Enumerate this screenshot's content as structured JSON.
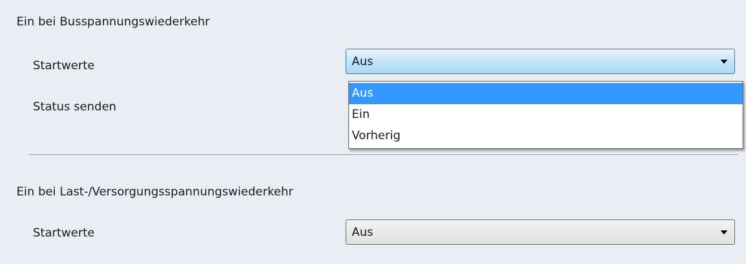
{
  "section1": {
    "title": "Ein bei Busspannungswiederkehr",
    "startwerte_label": "Startwerte",
    "startwerte_value": "Aus",
    "status_label": "Status senden",
    "dropdown_options": [
      "Aus",
      "Ein",
      "Vorherig"
    ],
    "dropdown_selected": "Aus"
  },
  "section2": {
    "title": "Ein bei Last-/Versorgungsspannungswiederkehr",
    "startwerte_label": "Startwerte",
    "startwerte_value": "Aus"
  },
  "colors": {
    "background": "#e9eef5",
    "selection": "#3399ff"
  },
  "icons": {
    "dropdown_arrow": "chevron-down-icon"
  }
}
